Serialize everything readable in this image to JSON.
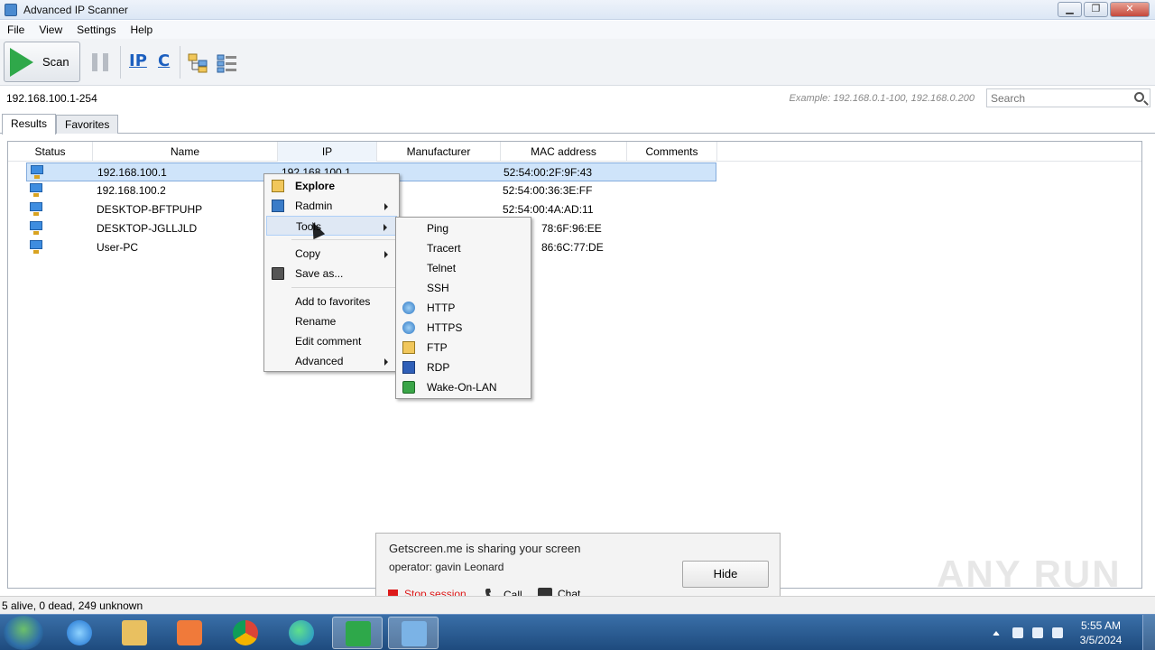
{
  "window": {
    "title": "Advanced IP Scanner",
    "minimize": "▁",
    "maximize": "❐",
    "close": "✕"
  },
  "menu": [
    "File",
    "View",
    "Settings",
    "Help"
  ],
  "toolbar": {
    "scan_label": "Scan",
    "ip_label": "IP",
    "c_label": "C"
  },
  "address": {
    "range": "192.168.100.1-254",
    "example": "Example: 192.168.0.1-100, 192.168.0.200",
    "search_placeholder": "Search"
  },
  "tabs": [
    "Results",
    "Favorites"
  ],
  "columns": [
    "Status",
    "Name",
    "IP",
    "Manufacturer",
    "MAC address",
    "Comments"
  ],
  "rows": [
    {
      "name": "192.168.100.1",
      "ip": "192.168.100.1",
      "mac": "52:54:00:2F:9F:43"
    },
    {
      "name": "192.168.100.2",
      "ip": "",
      "mac": "52:54:00:36:3E:FF"
    },
    {
      "name": "DESKTOP-BFTPUHP",
      "ip": "",
      "mac": "52:54:00:4A:AD:11"
    },
    {
      "name": "DESKTOP-JGLLJLD",
      "ip": "",
      "mac": "78:6F:96:EE"
    },
    {
      "name": "User-PC",
      "ip": "",
      "mac": "86:6C:77:DE"
    }
  ],
  "context_menu": {
    "explore": "Explore",
    "radmin": "Radmin",
    "tools": "Tools",
    "copy": "Copy",
    "save_as": "Save as...",
    "add_favorites": "Add to favorites",
    "rename": "Rename",
    "edit_comment": "Edit comment",
    "advanced": "Advanced"
  },
  "tools_submenu": [
    "Ping",
    "Tracert",
    "Telnet",
    "SSH",
    "HTTP",
    "HTTPS",
    "FTP",
    "RDP",
    "Wake-On-LAN"
  ],
  "notification": {
    "title": "Getscreen.me is sharing your screen",
    "operator": "operator: gavin Leonard",
    "hide": "Hide",
    "stop": "Stop session",
    "call": "Call",
    "chat": "Chat"
  },
  "watermark": "ANY RUN",
  "status": "5 alive, 0 dead, 249 unknown",
  "clock": {
    "time": "5:55 AM",
    "date": "3/5/2024"
  },
  "colors": {
    "accent": "#2fa84a",
    "selection": "#cfe4fa",
    "stop": "#dd1a1a"
  }
}
